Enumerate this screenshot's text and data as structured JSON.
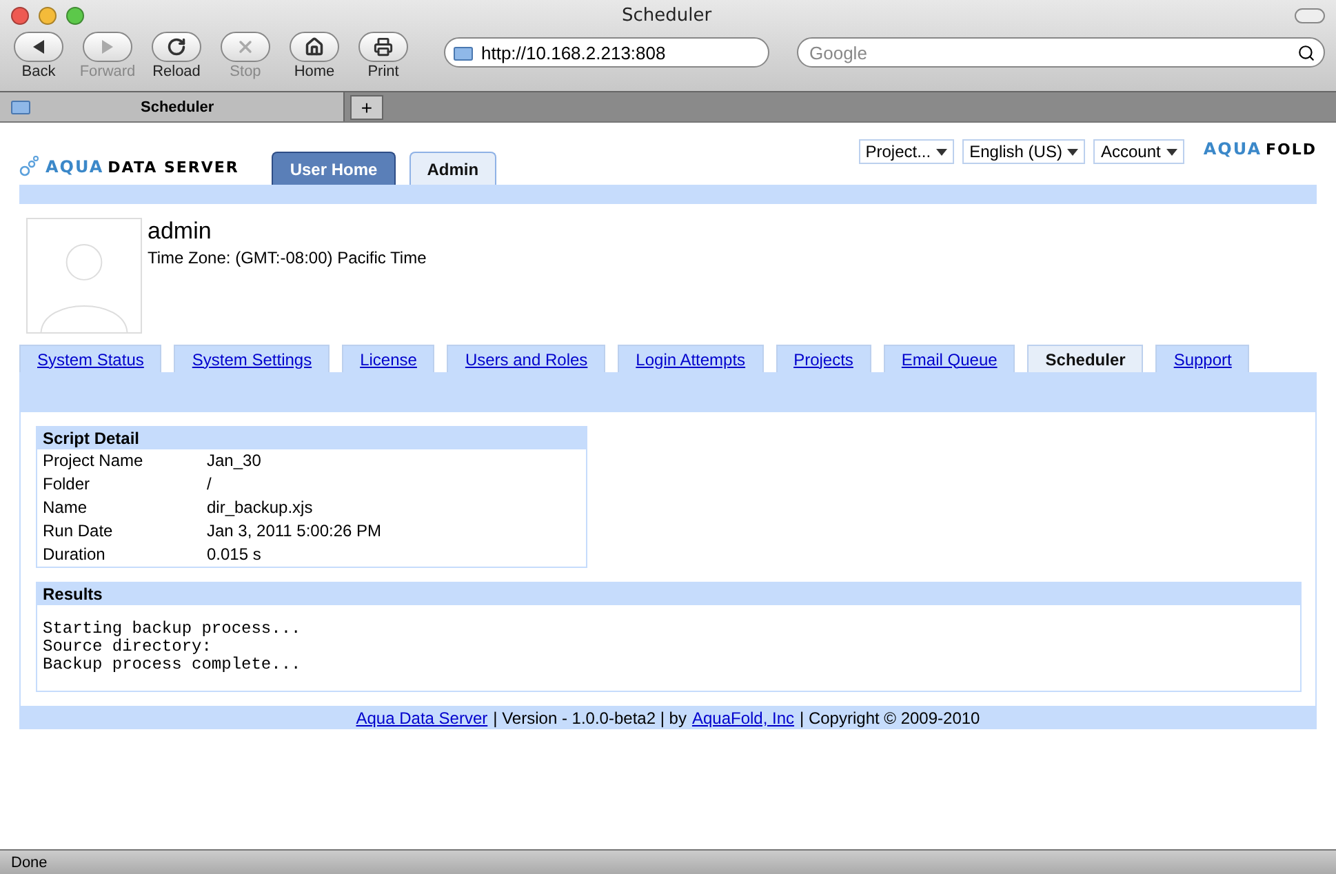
{
  "window": {
    "title": "Scheduler"
  },
  "toolbar": [
    {
      "kind": "back",
      "label": "Back",
      "disabled": false
    },
    {
      "kind": "forward",
      "label": "Forward",
      "disabled": true
    },
    {
      "kind": "reload",
      "label": "Reload",
      "disabled": false
    },
    {
      "kind": "stop",
      "label": "Stop",
      "disabled": true
    },
    {
      "kind": "home",
      "label": "Home",
      "disabled": false
    },
    {
      "kind": "print",
      "label": "Print",
      "disabled": false
    }
  ],
  "address": {
    "value": "http://10.168.2.213:808"
  },
  "search": {
    "placeholder": "Google"
  },
  "browser_tabs": [
    {
      "label": "Scheduler",
      "selected": true
    }
  ],
  "new_tab": "+",
  "logo": {
    "accent": "AQUA",
    "rest": "DATA SERVER"
  },
  "brand": {
    "accent": "AQUA",
    "rest": "FOLD"
  },
  "nav_tabs": [
    {
      "label": "User Home",
      "selected": false
    },
    {
      "label": "Admin",
      "selected": true
    }
  ],
  "menus": [
    {
      "label": "Project..."
    },
    {
      "label": "English (US)"
    },
    {
      "label": "Account"
    }
  ],
  "profile": {
    "name": "admin",
    "timezone": "Time Zone: (GMT:-08:00) Pacific Time"
  },
  "admin_tabs": [
    {
      "label": "System Status",
      "selected": false
    },
    {
      "label": "System Settings",
      "selected": false
    },
    {
      "label": "License",
      "selected": false
    },
    {
      "label": "Users and Roles",
      "selected": false
    },
    {
      "label": "Login Attempts",
      "selected": false
    },
    {
      "label": "Projects",
      "selected": false
    },
    {
      "label": "Email Queue",
      "selected": false
    },
    {
      "label": "Scheduler",
      "selected": true
    },
    {
      "label": "Support",
      "selected": false
    }
  ],
  "script_detail": {
    "title": "Script Detail",
    "rows": [
      {
        "label": "Project Name",
        "value": "Jan_30"
      },
      {
        "label": "Folder",
        "value": "/"
      },
      {
        "label": "Name",
        "value": "dir_backup.xjs"
      },
      {
        "label": "Run Date",
        "value": "Jan 3, 2011 5:00:26 PM"
      },
      {
        "label": "Duration",
        "value": "0.015 s"
      }
    ]
  },
  "results": {
    "title": "Results",
    "lines": [
      "Starting backup process...",
      "Source directory:",
      "Backup process complete..."
    ]
  },
  "footer": [
    {
      "kind": "link",
      "text": "Aqua Data Server"
    },
    {
      "kind": "text",
      "text": "| Version - 1.0.0-beta2 | by"
    },
    {
      "kind": "link",
      "text": "AquaFold, Inc"
    },
    {
      "kind": "text",
      "text": "| Copyright © 2009-2010"
    }
  ],
  "status_bar": {
    "text": "Done"
  }
}
